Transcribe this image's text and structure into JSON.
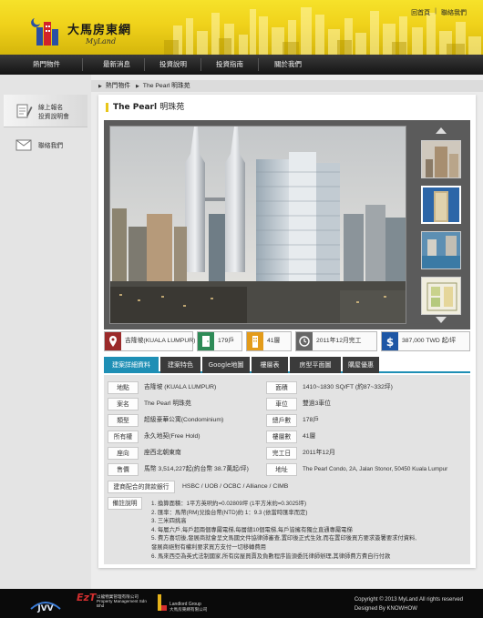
{
  "header": {
    "logo_cn": "大馬房東網",
    "logo_en": "MyLand",
    "top_links": [
      "回首頁",
      "聯絡我們"
    ]
  },
  "nav": [
    "熱門物件",
    "最新消息",
    "投資說明",
    "投資指南",
    "關於我們"
  ],
  "sidebar": [
    {
      "label_line1": "線上報名",
      "label_line2": "投資說明會"
    },
    {
      "label_line1": "聯絡我們",
      "label_line2": ""
    }
  ],
  "breadcrumb": {
    "parent": "熱門物件",
    "current": "The Pearl 明珠苑"
  },
  "property": {
    "title_en": "The Pearl",
    "title_cn": "明珠苑"
  },
  "strip": {
    "location": "吉隆坡(KUALA LUMPUR)",
    "units": "179戶",
    "floors": "41層",
    "completion": "2011年12月完工",
    "price": "387,000 TWD 起/坪"
  },
  "tabs": [
    "建案詳細資料",
    "建案特色",
    "Google地圖",
    "樓層表",
    "房型平面圖",
    "購屋優惠"
  ],
  "details": {
    "rows": [
      {
        "l1": "地點",
        "v1": "吉隆坡 (KUALA LUMPUR)",
        "l2": "面積",
        "v2": "1410~1830 SQ/FT (約87~332坪)"
      },
      {
        "l1": "案名",
        "v1": "The Pearl 明珠苑",
        "l2": "車位",
        "v2": "雙過3車位"
      },
      {
        "l1": "類型",
        "v1": "超級豪華公寓(Condominium)",
        "l2": "總戶數",
        "v2": "178戶"
      },
      {
        "l1": "所有權",
        "v1": "永久地契(Free Hold)",
        "l2": "樓層數",
        "v2": "41層"
      },
      {
        "l1": "座向",
        "v1": "座西北朝東南",
        "l2": "完工日",
        "v2": "2011年12月"
      },
      {
        "l1": "售價",
        "v1": "馬幣 3,514,227起(約台幣 38.7萬起/坪)",
        "l2": "地址",
        "v2": "The Pearl Condo, 2A, Jalan Stonor, 50450 Kuala Lumpur"
      }
    ],
    "banks_label": "建商配合的貸款銀行",
    "banks": "HSBC / UOB / OCBC / Alliance / CIMB",
    "notes_label": "備註說明",
    "notes": [
      "1. 換算面積：1平方英呎約=0.02809坪 (1平方米約=0.3025坪)",
      "2. 匯率：馬幣(RM)兌換台幣(NTD)約 1：9.3 (依當時匯率而定)",
      "3. 三米四挑高",
      "4. 每層六戶,每戶超兩個專屬電梯,每層總10個電梯,每戶皆擁有獨立直通專屬電梯",
      "5. 費方喜切後,發展商就會呈文馬國文件協律師審查,置印後正式生效,而在置印後買方要求簽署要求付資料,",
      "   發展商絕對有權利要求買方支付一切移轉費用",
      "6. 馬來西亞為英式法制國家,所有房屋買賣及負數程序皆須委託律師辦理,其律師費方費自行付款"
    ]
  },
  "footer": {
    "copyright": "Copyright © 2013  MyLand All rights reserved",
    "designed": "Designed By  KNOWHOW",
    "logo2_text": "Property Management Sdn Bhd",
    "logo2_cn": "以龍物業管理有限公司",
    "logo3_text": "Landlord Group",
    "logo3_cn": "大馬房東網有限公司"
  }
}
